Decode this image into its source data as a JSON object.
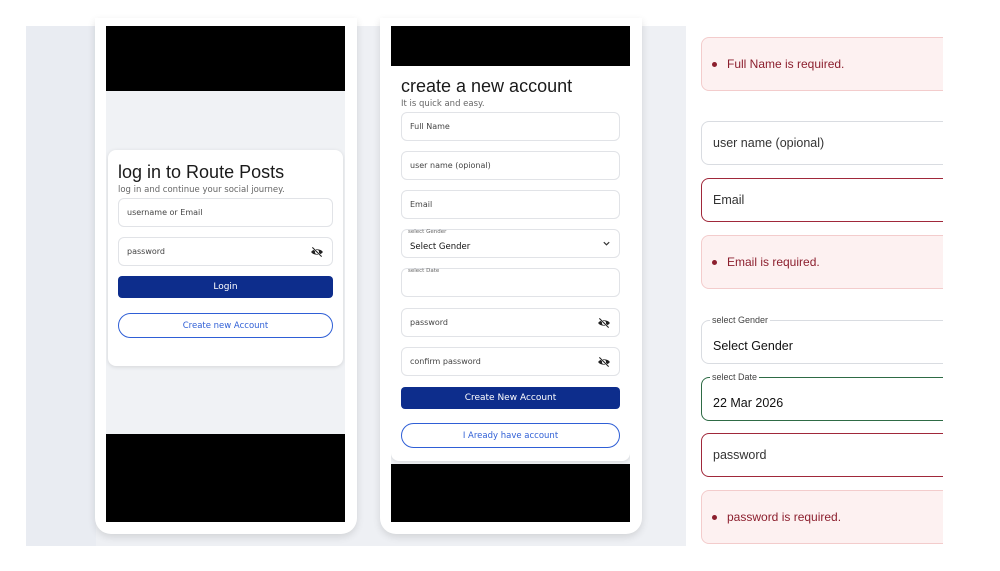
{
  "login": {
    "title": "log in to Route Posts",
    "subtitle": "log in and continue your social journey.",
    "username_placeholder": "username or Email",
    "password_placeholder": "password",
    "login_label": "Login",
    "create_label": "Create new Account"
  },
  "register": {
    "title": "create a new account",
    "subtitle": "It is quick and easy.",
    "fullname_placeholder": "Full Name",
    "username_placeholder": "user name (opional)",
    "email_placeholder": "Email",
    "gender_label": "select Gender",
    "gender_value": "Select Gender",
    "date_label": "select Date",
    "password_placeholder": "password",
    "confirm_placeholder": "confirm password",
    "create_label": "Create New Account",
    "have_account_label": "I Aready have account"
  },
  "zoom": {
    "fullname_error": "Full Name is required.",
    "username_placeholder": "user name (opional)",
    "email_placeholder": "Email",
    "email_error": "Email is required.",
    "gender_label": "select Gender",
    "gender_value": "Select Gender",
    "date_label": "select Date",
    "date_value": "22 Mar 2026",
    "password_placeholder": "password",
    "password_error": "password is required."
  },
  "colors": {
    "primary": "#0d2d8c",
    "outline": "#2f5fd6",
    "error": "#8c1f2e",
    "error_bg": "#fdf1f1",
    "valid_border": "#2e6b45"
  },
  "icons": {
    "password_toggle": "eye-off-icon",
    "dropdown": "chevron-down-icon"
  }
}
